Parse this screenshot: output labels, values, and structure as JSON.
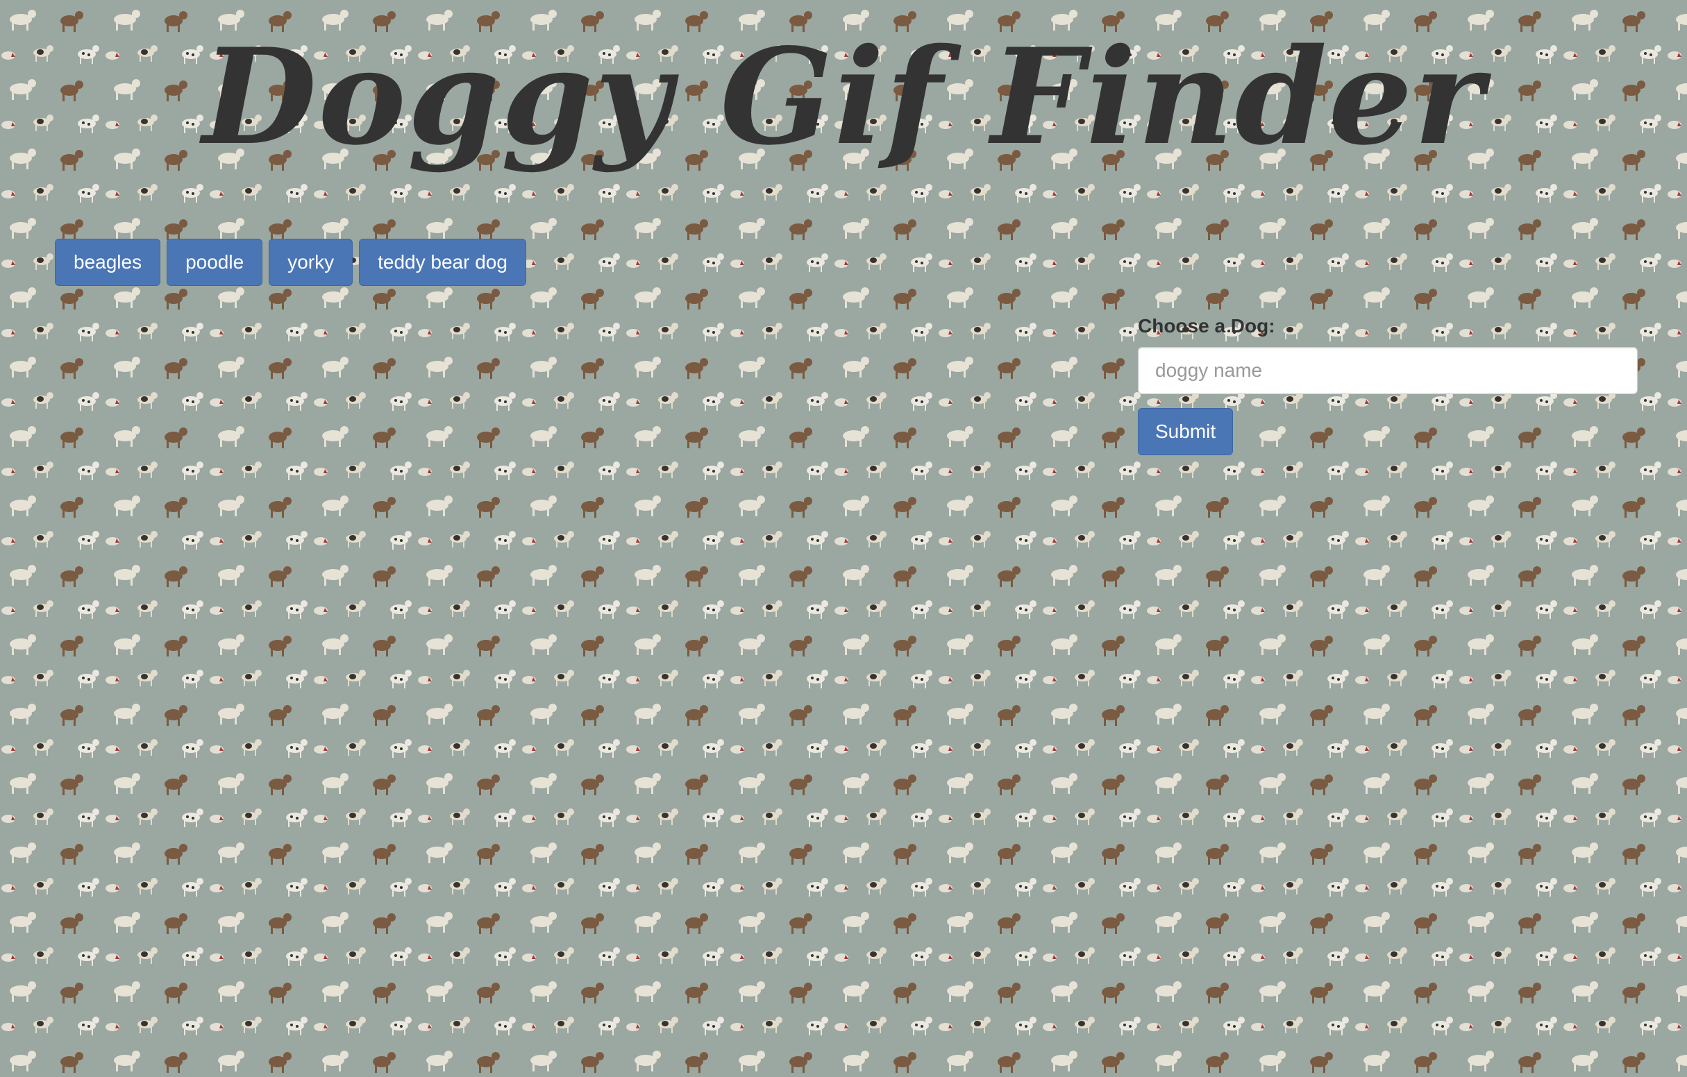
{
  "page": {
    "title": "Doggy Gif Finder",
    "background_color": "#9ba7a1"
  },
  "dog_buttons": [
    {
      "label": "beagles"
    },
    {
      "label": "poodle"
    },
    {
      "label": "yorky"
    },
    {
      "label": "teddy bear dog"
    }
  ],
  "form": {
    "label": "Choose a Dog:",
    "input_placeholder": "doggy name",
    "input_value": "",
    "submit_label": "Submit"
  },
  "colors": {
    "button_primary": "#4b76b6",
    "title_text": "#333333"
  }
}
